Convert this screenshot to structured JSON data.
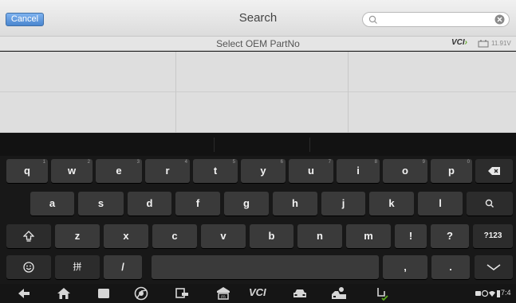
{
  "header": {
    "cancel_label": "Cancel",
    "title": "Search",
    "search_placeholder": "",
    "search_value": ""
  },
  "subheader": {
    "label": "Select OEM PartNo",
    "vci_text": "VCI",
    "voltage": "11.91V"
  },
  "keyboard": {
    "row1": [
      {
        "label": "q",
        "hint": "1"
      },
      {
        "label": "w",
        "hint": "2"
      },
      {
        "label": "e",
        "hint": "3"
      },
      {
        "label": "r",
        "hint": "4"
      },
      {
        "label": "t",
        "hint": "5"
      },
      {
        "label": "y",
        "hint": "6"
      },
      {
        "label": "u",
        "hint": "7"
      },
      {
        "label": "i",
        "hint": "8"
      },
      {
        "label": "o",
        "hint": "9"
      },
      {
        "label": "p",
        "hint": "0"
      }
    ],
    "row2": [
      "a",
      "s",
      "d",
      "f",
      "g",
      "h",
      "j",
      "k",
      "l"
    ],
    "row3": [
      "z",
      "x",
      "c",
      "v",
      "b",
      "n",
      "m",
      "!",
      "?"
    ],
    "row3_symbols": "?123",
    "row4_lang": "拼",
    "row4_slash": "/",
    "row4_comma": ",",
    "row4_period": "."
  },
  "navbar": {
    "vci_label": "VCI",
    "clock": "7:4"
  }
}
